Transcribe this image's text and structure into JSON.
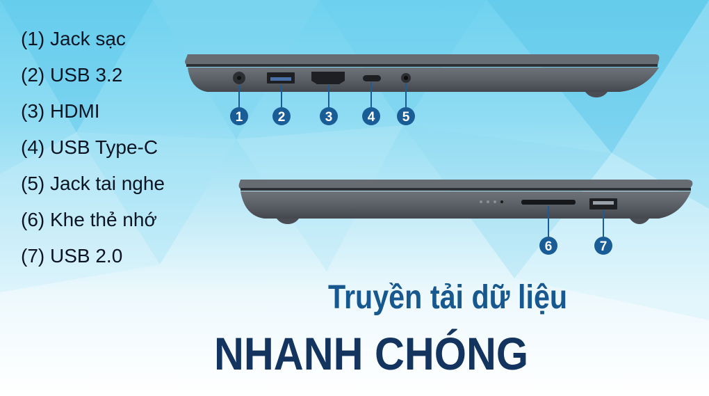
{
  "ports": [
    {
      "number": "1",
      "label": "(1) Jack sạc"
    },
    {
      "number": "2",
      "label": "(2) USB 3.2"
    },
    {
      "number": "3",
      "label": "(3) HDMI"
    },
    {
      "number": "4",
      "label": "(4) USB Type-C"
    },
    {
      "number": "5",
      "label": "(5) Jack tai nghe"
    },
    {
      "number": "6",
      "label": "(6) Khe thẻ nhớ"
    },
    {
      "number": "7",
      "label": "(7) USB 2.0"
    }
  ],
  "headline": "Truyền tải dữ liệu",
  "subheadline": "NHANH CHÓNG",
  "colors": {
    "marker": "#1a5c96",
    "laptop_body": "#5b5f66",
    "headline": "#17588f",
    "subheadline": "#13345e"
  }
}
